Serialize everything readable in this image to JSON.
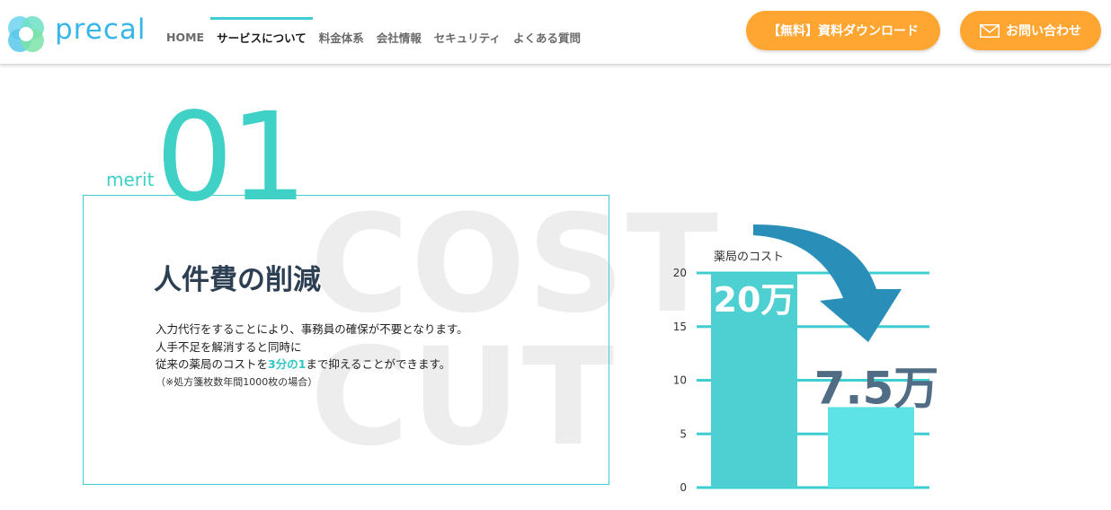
{
  "header": {
    "logo_text": "precal",
    "nav": [
      {
        "label": "HOME",
        "active": false
      },
      {
        "label": "サービスについて",
        "active": true
      },
      {
        "label": "料金体系",
        "active": false
      },
      {
        "label": "会社情報",
        "active": false
      },
      {
        "label": "セキュリティ",
        "active": false
      },
      {
        "label": "よくある質問",
        "active": false
      }
    ],
    "download_button": "【無料】資料ダウンロード",
    "contact_button": "お問い合わせ"
  },
  "merit": {
    "label": "merit",
    "number": "01",
    "bg_word_1": "COST",
    "bg_word_2": "CUT",
    "title": "人件費の削減",
    "desc_line1": "入力代行をすることにより、事務員の確保が不要となります。",
    "desc_line2": "人手不足を解消すると同時に",
    "desc_line3_a": "従来の薬局のコストを",
    "desc_line3_hl": "3分の1",
    "desc_line3_b": "まで抑えることができます。",
    "note": "（※処方箋枚数年間1000枚の場合）"
  },
  "colors": {
    "accent": "#3ecdd0",
    "orange": "#ffa532",
    "bar_1": "#4ecfd1",
    "bar_2": "#5de3e6",
    "arrow": "#2a8fb8",
    "value_2": "#516d86"
  },
  "chart_data": {
    "type": "bar",
    "title": "薬局のコスト",
    "yticks": [
      0,
      5,
      10,
      15,
      20
    ],
    "ylim": [
      0,
      20
    ],
    "values": [
      20,
      7.5
    ],
    "value_labels": [
      "20万",
      "7.5万"
    ],
    "grid": true
  }
}
